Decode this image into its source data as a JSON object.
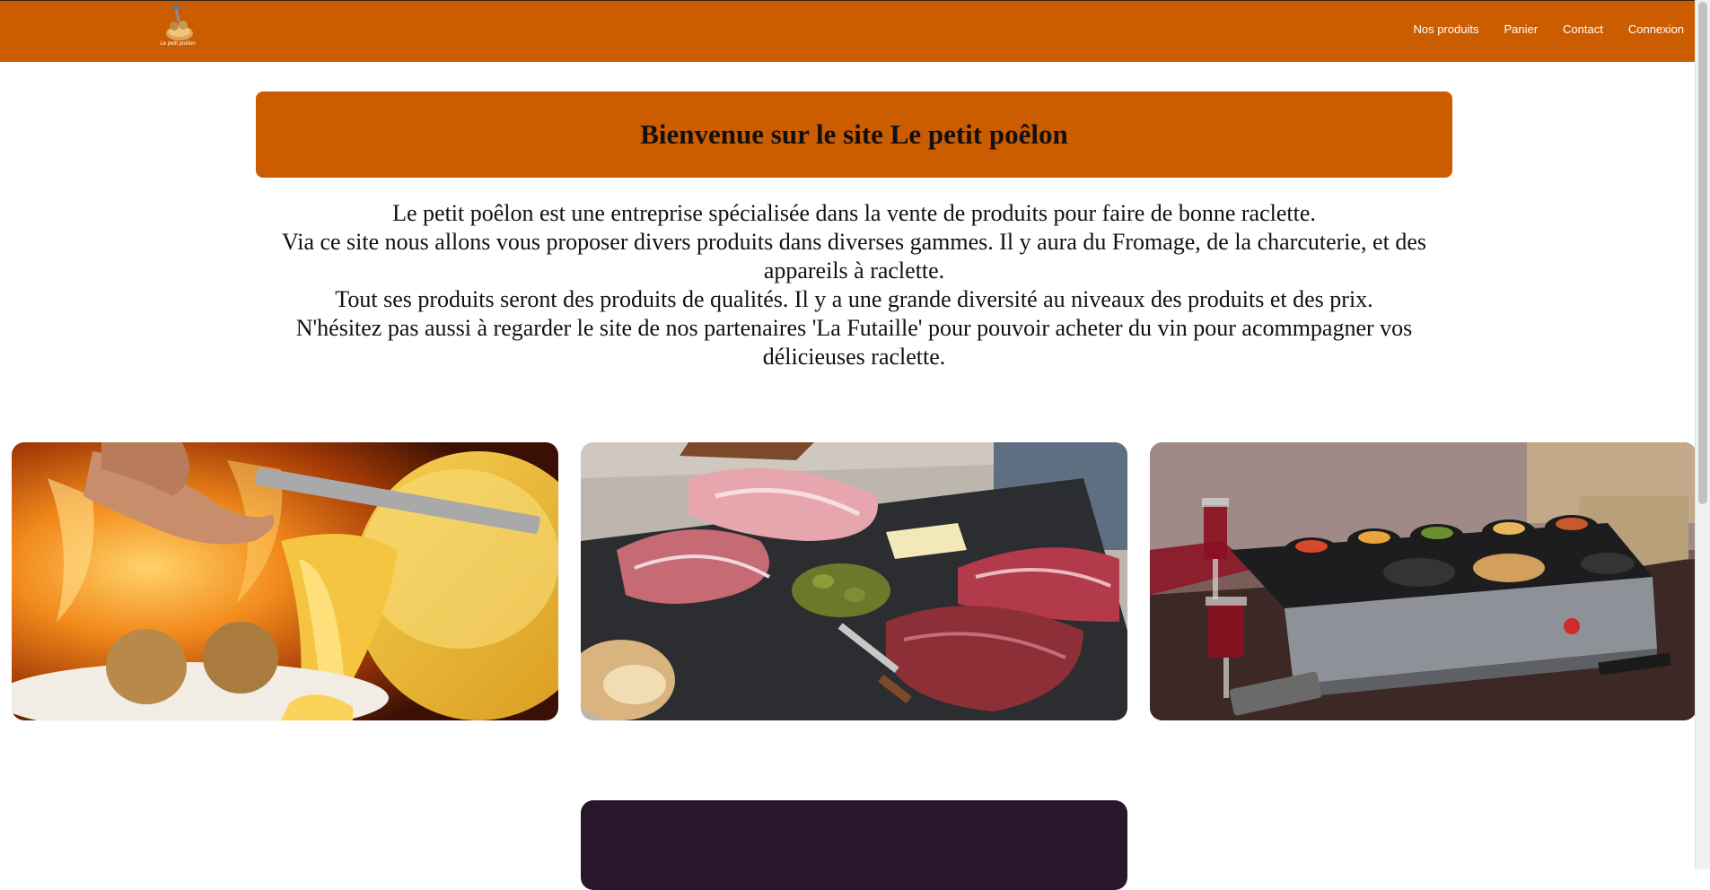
{
  "navbar": {
    "logo_text": "Le petit poêlon",
    "links": [
      {
        "label": "Nos produits"
      },
      {
        "label": "Panier"
      },
      {
        "label": "Contact"
      },
      {
        "label": "Connexion"
      }
    ]
  },
  "banner": {
    "title": "Bienvenue sur le site Le petit poêlon"
  },
  "intro": {
    "lines": [
      "Le petit poêlon est une entreprise spécialisée dans la vente de produits pour faire de bonne raclette.",
      "Via ce site nous allons vous proposer divers produits dans diverses gammes. Il y aura du Fromage, de la charcuterie, et des appareils à raclette.",
      "Tout ses produits seront des produits de qualités. Il y a une grande diversité au niveaux des produits et des prix.",
      "N'hésitez pas aussi à regarder le site de nos partenaires 'La Futaille' pour pouvoir acheter du vin pour acommpagner vos délicieuses raclette."
    ]
  },
  "cards": [
    {
      "subject": "melted-raclette-cheese-photo"
    },
    {
      "subject": "charcuterie-board-photo"
    },
    {
      "subject": "raclette-grill-photo"
    }
  ],
  "colors": {
    "brand_orange": "#cc5c00",
    "dark_panel": "#28172a"
  }
}
